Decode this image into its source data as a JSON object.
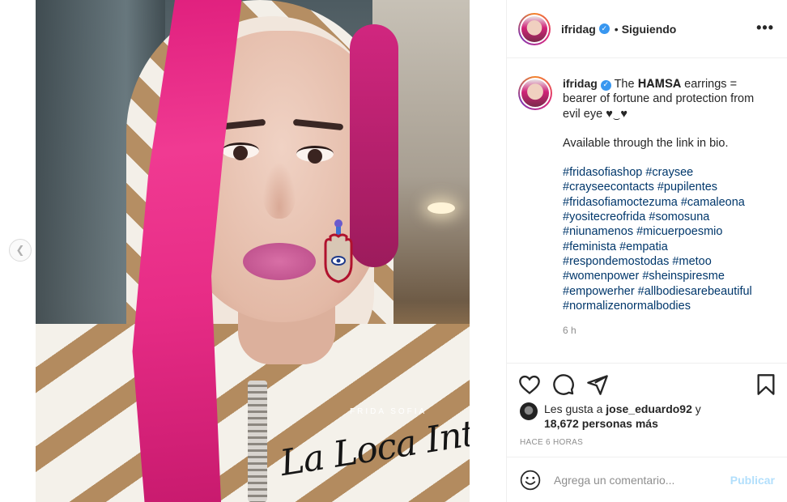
{
  "post": {
    "username": "ifridag",
    "follow_status": "Siguiendo",
    "more_label": "•••",
    "photo_alt": "Selfie de ifridag con capucha y cabello rosa",
    "brand_small": "FRIDA SOFIA",
    "brand_script": "La Loca Inteligente"
  },
  "caption": {
    "username": "ifridag",
    "text_line1": "The 𝐇𝐀𝐌𝐒𝐀 earrings = bearer of fortune and protection from evil eye ♥‿♥",
    "text_line2": "Available through the link in bio.",
    "hashtags": [
      "#fridasofiashop #craysee",
      "#crayseecontacts #pupilentes",
      "#fridasofiamoctezuma #camaleona",
      "#yositecreofrida #somosuna",
      "#niunamenos #micuerpoesmio",
      "#feminista #empatia",
      "#respondemostodas #metoo",
      "#womenpower #sheinspiresme",
      "#empowerher #allbodiesarebeautiful",
      "#normalizenormalbodies"
    ],
    "time_ago": "6 h"
  },
  "likes": {
    "prefix": "Les gusta a ",
    "user": "jose_eduardo92",
    "connector": " y",
    "count_text": "18,672 personas más"
  },
  "posted": "HACE 6 HORAS",
  "comment": {
    "placeholder": "Agrega un comentario...",
    "publish_label": "Publicar"
  },
  "colors": {
    "link": "#00376b",
    "verified": "#3897f0",
    "publish_disabled": "#b2dffc"
  },
  "icons": [
    "chevron-left-icon",
    "verified-icon",
    "more-icon",
    "heart-icon",
    "comment-icon",
    "share-icon",
    "bookmark-icon",
    "emoji-icon"
  ]
}
